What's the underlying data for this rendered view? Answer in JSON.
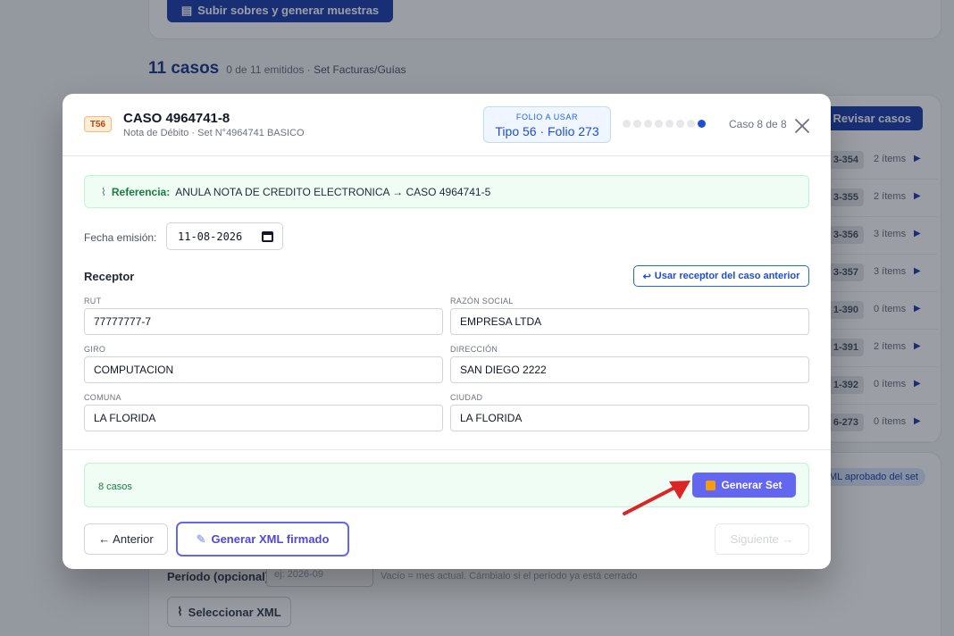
{
  "background": {
    "upload_button": "Subir sobres y generar muestras",
    "cases_count": "11 casos",
    "cases_summary": "0 de 11 emitidos ·",
    "set_name": "Set Facturas/Guías",
    "review_button": "Revisar casos",
    "rows": [
      {
        "tag": "3-354",
        "items": "2 ítems"
      },
      {
        "tag": "3-355",
        "items": "2 ítems"
      },
      {
        "tag": "3-356",
        "items": "3 ítems"
      },
      {
        "tag": "3-357",
        "items": "3 ítems"
      },
      {
        "tag": "1-390",
        "items": "0 ítems"
      },
      {
        "tag": "1-391",
        "items": "2 ítems"
      },
      {
        "tag": "1-392",
        "items": "0 ítems"
      },
      {
        "tag": "6-273",
        "items": "0 ítems"
      }
    ],
    "approved_badge": "ML aprobado del set",
    "period_label": "Período (opcional):",
    "period_placeholder": "ej: 2026-09",
    "period_hint": "Vacío = mes actual. Cámbialo si el período ya está cerrado",
    "select_xml_button": "Seleccionar XML"
  },
  "modal": {
    "doc_badge": "T56",
    "case_title": "CASO 4964741-8",
    "case_subtitle": "Nota de Débito · Set N°4964741 BASICO",
    "folio_label": "FOLIO A USAR",
    "folio_value": "Tipo 56 · Folio 273",
    "progress": {
      "current": 8,
      "total": 8
    },
    "case_counter": "Caso 8 de 8",
    "reference_label": "Referencia:",
    "reference_text": "ANULA NOTA DE CREDITO ELECTRONICA → CASO 4964741-5",
    "date_label": "Fecha emisión:",
    "date_value": "11-08-2026",
    "receptor_title": "Receptor",
    "use_previous_button": "Usar receptor del caso anterior",
    "fields": {
      "rut": {
        "label": "RUT",
        "value": "77777777-7"
      },
      "razon_social": {
        "label": "RAZÓN SOCIAL",
        "value": "EMPRESA LTDA"
      },
      "giro": {
        "label": "GIRO",
        "value": "COMPUTACION"
      },
      "direccion": {
        "label": "DIRECCIÓN",
        "value": "SAN DIEGO 2222"
      },
      "comuna": {
        "label": "COMUNA",
        "value": "LA FLORIDA"
      },
      "ciudad": {
        "label": "CIUDAD",
        "value": "LA FLORIDA"
      }
    },
    "set_count": "8 casos",
    "generate_set_button": "Generar Set",
    "previous_button": "← Anterior",
    "generate_xml_button": "Generar XML firmado",
    "next_button": "Siguiente →"
  },
  "colors": {
    "primary": "#1e40af",
    "accent": "#6366f1",
    "success_bg": "#f0fdf4",
    "success_text": "#15803d",
    "arrow": "#dc2626"
  }
}
